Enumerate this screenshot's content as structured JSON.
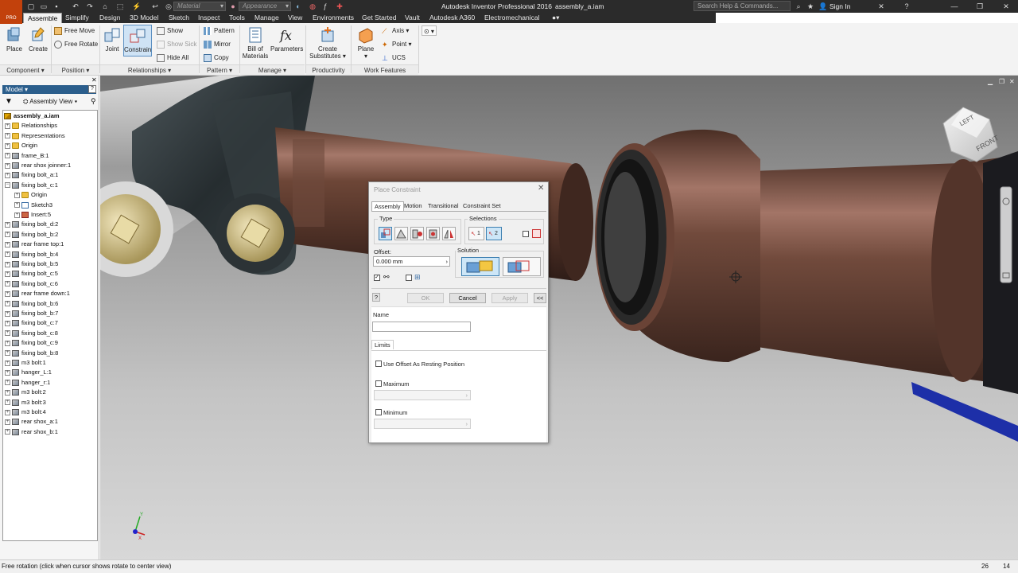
{
  "app": {
    "title": "Autodesk Inventor Professional 2016",
    "document": "assembly_a.iam",
    "badge": "PRO"
  },
  "quick_access": {
    "material_placeholder": "Material",
    "appearance_placeholder": "Appearance",
    "search_placeholder": "Search Help & Commands...",
    "sign_in": "Sign In"
  },
  "menu": {
    "tabs": [
      "Assemble",
      "Simplify",
      "Design",
      "3D Model",
      "Sketch",
      "Inspect",
      "Tools",
      "Manage",
      "View",
      "Environments",
      "Get Started",
      "Vault",
      "Autodesk A360",
      "Electromechanical"
    ],
    "active": "Assemble"
  },
  "ribbon": {
    "component": {
      "place": "Place",
      "create": "Create",
      "label": "Component"
    },
    "position": {
      "free_move": "Free Move",
      "free_rotate": "Free Rotate",
      "label": "Position"
    },
    "relationships": {
      "joint": "Joint",
      "constrain": "Constrain",
      "show": "Show",
      "show_sick": "Show Sick",
      "hide_all": "Hide All",
      "label": "Relationships"
    },
    "pattern": {
      "pattern": "Pattern",
      "mirror": "Mirror",
      "copy": "Copy",
      "label": "Pattern"
    },
    "manage": {
      "bom_line1": "Bill of",
      "bom_line2": "Materials",
      "parameters": "Parameters",
      "label": "Manage"
    },
    "productivity": {
      "line1": "Create",
      "line2": "Substitutes",
      "label": "Productivity"
    },
    "work_features": {
      "plane": "Plane",
      "axis": "Axis",
      "point": "Point",
      "ucs": "UCS",
      "label": "Work Features"
    }
  },
  "browser": {
    "header": "Model",
    "view": "Assembly View",
    "items": [
      {
        "label": "assembly_a.iam",
        "icon": "assembly-icon",
        "level": 0,
        "bold": true
      },
      {
        "label": "Relationships",
        "icon": "folder-icon",
        "level": 1
      },
      {
        "label": "Representations",
        "icon": "folder-icon",
        "level": 1
      },
      {
        "label": "Origin",
        "icon": "folder-icon",
        "level": 1
      },
      {
        "label": "frame_B:1",
        "icon": "part-icon",
        "level": 1
      },
      {
        "label": "rear shox joinner:1",
        "icon": "part-icon",
        "level": 1
      },
      {
        "label": "fixing bolt_a:1",
        "icon": "part-icon",
        "level": 1
      },
      {
        "label": "fixing bolt_c:1",
        "icon": "part-icon",
        "level": 1,
        "expanded": true
      },
      {
        "label": "Origin",
        "icon": "folder-icon",
        "level": 2
      },
      {
        "label": "Sketch3",
        "icon": "sketch-icon",
        "level": 2
      },
      {
        "label": "Insert:5",
        "icon": "insert-icon",
        "level": 2
      },
      {
        "label": "fixing bolt_d:2",
        "icon": "part-icon",
        "level": 1
      },
      {
        "label": "fixing bolt_b:2",
        "icon": "part-icon",
        "level": 1
      },
      {
        "label": "rear frame top:1",
        "icon": "part-icon",
        "level": 1
      },
      {
        "label": "fixing bolt_b:4",
        "icon": "part-icon",
        "level": 1
      },
      {
        "label": "fixing bolt_b:5",
        "icon": "part-icon",
        "level": 1
      },
      {
        "label": "fixing bolt_c:5",
        "icon": "part-icon",
        "level": 1
      },
      {
        "label": "fixing bolt_c:6",
        "icon": "part-icon",
        "level": 1
      },
      {
        "label": "rear frame down:1",
        "icon": "part-icon",
        "level": 1
      },
      {
        "label": "fixing bolt_b:6",
        "icon": "part-icon",
        "level": 1
      },
      {
        "label": "fixing bolt_b:7",
        "icon": "part-icon",
        "level": 1
      },
      {
        "label": "fixing bolt_c:7",
        "icon": "part-icon",
        "level": 1
      },
      {
        "label": "fixing bolt_c:8",
        "icon": "part-icon",
        "level": 1
      },
      {
        "label": "fixing bolt_c:9",
        "icon": "part-icon",
        "level": 1
      },
      {
        "label": "fixing bolt_b:8",
        "icon": "part-icon",
        "level": 1
      },
      {
        "label": "m3 bolt:1",
        "icon": "part-icon",
        "level": 1
      },
      {
        "label": "hanger_L:1",
        "icon": "part-icon",
        "level": 1
      },
      {
        "label": "hanger_r:1",
        "icon": "part-icon",
        "level": 1
      },
      {
        "label": "m3 bolt:2",
        "icon": "part-icon",
        "level": 1
      },
      {
        "label": "m3 bolt:3",
        "icon": "part-icon",
        "level": 1
      },
      {
        "label": "m3 bolt:4",
        "icon": "part-icon",
        "level": 1
      },
      {
        "label": "rear shox_a:1",
        "icon": "part-icon",
        "level": 1
      },
      {
        "label": "rear shox_b:1",
        "icon": "part-icon",
        "level": 1
      }
    ]
  },
  "viewcube": {
    "left": "LEFT",
    "front": "FRONT"
  },
  "dialog": {
    "title": "Place Constraint",
    "tabs": [
      "Assembly",
      "Motion",
      "Transitional",
      "Constraint Set"
    ],
    "active_tab": "Assembly",
    "type_label": "Type",
    "selections_label": "Selections",
    "selection_1": "1",
    "selection_2": "2",
    "offset_label": "Offset:",
    "offset_value": "0.000 mm",
    "solution_label": "Solution",
    "ok": "OK",
    "cancel": "Cancel",
    "apply": "Apply",
    "collapse": "<<",
    "help": "?",
    "name_label": "Name",
    "name_value": "",
    "limits_tab": "Limits",
    "use_offset": "Use Offset As Resting Position",
    "maximum": "Maximum",
    "minimum": "Minimum"
  },
  "status": {
    "message": "Free rotation (click when cursor shows rotate to center view)",
    "count_a": "26",
    "count_b": "14"
  },
  "colors": {
    "accent": "#2b5e8c",
    "app_button": "#c2410c",
    "bronze": "#7a4a38",
    "frame": "#2e3436"
  }
}
